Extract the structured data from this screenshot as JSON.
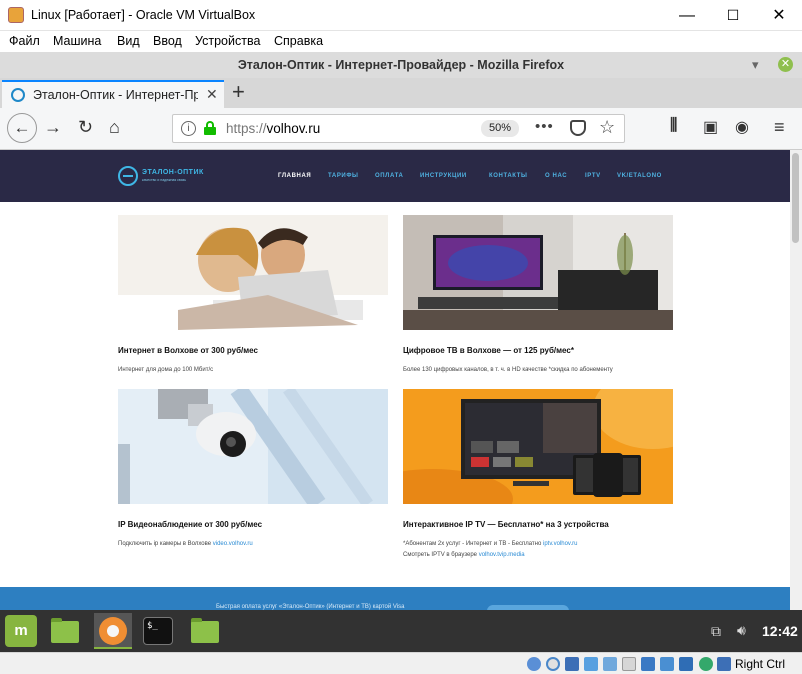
{
  "vbox": {
    "title": "Linux [Работает] - Oracle VM VirtualBox",
    "controls": {
      "minimize": "—",
      "maximize": "☐",
      "close": "✕"
    },
    "menu": [
      "Файл",
      "Машина",
      "Вид",
      "Ввод",
      "Устройства",
      "Справка"
    ],
    "host_key": "Right Ctrl"
  },
  "firefox": {
    "window_title": "Эталон-Оптик - Интернет-Провайдер - Mozilla Firefox",
    "tab_title": "Эталон-Оптик - Интернет-Провайдер",
    "url_scheme": "https://",
    "url_host": "volhov.ru",
    "zoom": "50%",
    "page_actions": "•••"
  },
  "site": {
    "logo_text": "ЭТАЛОН-ОПТИК",
    "logo_sub": "качество и надежная связь",
    "nav": [
      "ГЛАВНАЯ",
      "ТАРИФЫ",
      "ОПЛАТА",
      "ИНСТРУКЦИИ",
      "КОНТАКТЫ",
      "О НАС",
      "IPTV",
      "VK/ETALONO"
    ],
    "cards": [
      {
        "title": "Интернет в Волхове от 300 руб/мес",
        "line1": "Интернет для дома до 100 Мбит/с",
        "line1_link": "",
        "line2": "",
        "line2_link": ""
      },
      {
        "title": "Цифровое ТВ в Волхове — от 125 руб/мес*",
        "line1": "Более 130 цифровых каналов, в т. ч. в HD качестве *скидка по абонементу",
        "line1_link": "",
        "line2": "",
        "line2_link": ""
      },
      {
        "title": "IP Видеонаблюдение от 300 руб/мес",
        "line1": "Подключить ip камеры в Волхове ",
        "line1_link": "video.volhov.ru",
        "line2": "",
        "line2_link": ""
      },
      {
        "title": "Интерактивное IP TV — Бесплатно* на 3 устройства",
        "line1": "*Абонентам 2х услуг - Интернет и ТВ - Бесплатно  ",
        "line1_link": "iptv.volhov.ru",
        "line2": "Смотреть IPTV в браузере ",
        "line2_link": "volhov.tvip.media"
      }
    ],
    "footer_text": "Быстрая оплата услуг «Эталон-Оптик» (Интернет и ТВ) картой Visa"
  },
  "panel": {
    "menu_label": "m",
    "terminal_prompt": "$_",
    "clock": "12:42"
  },
  "colors": {
    "site_header": "#2a2946",
    "accent": "#3fb7e6",
    "footer": "#2d7fc1",
    "mint_green": "#87b540"
  }
}
